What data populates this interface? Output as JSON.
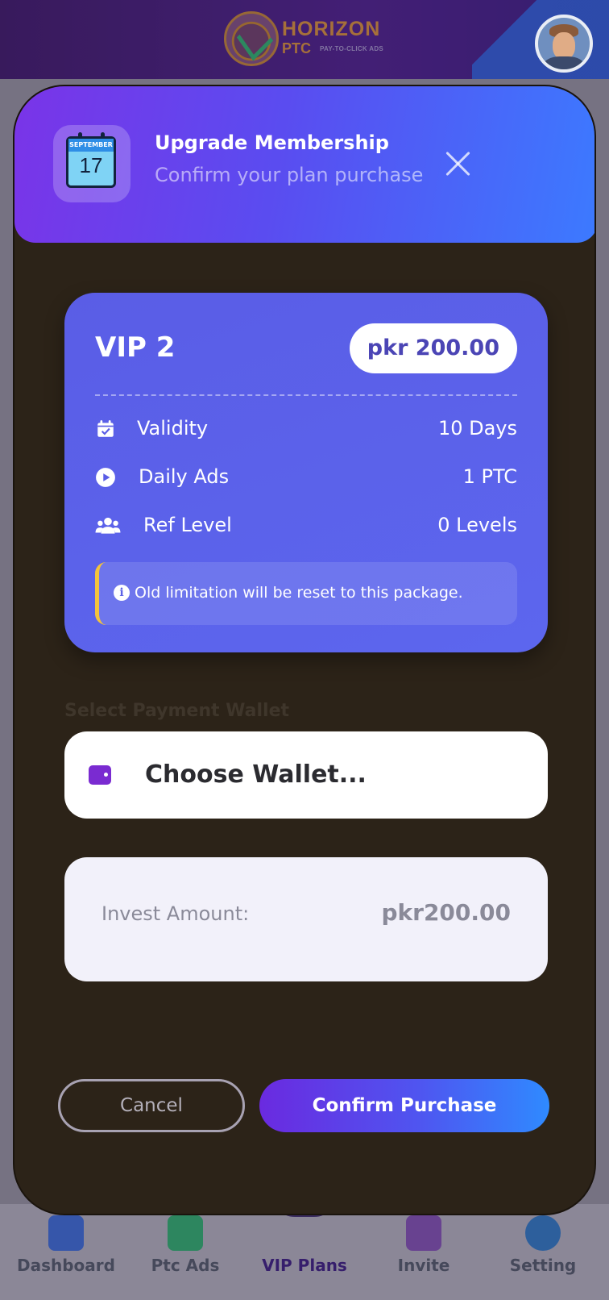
{
  "header": {
    "brand_name": "HORIZON",
    "brand_sub": "PTC",
    "brand_tag": "PAY-TO-CLICK ADS"
  },
  "bottom_nav": {
    "items": [
      {
        "label": "Dashboard",
        "icon": "dashboard-icon"
      },
      {
        "label": "Ptc Ads",
        "icon": "grid-plus-icon"
      },
      {
        "label": "VIP Plans",
        "icon": "crown-icon",
        "active": true
      },
      {
        "label": "Invite",
        "icon": "envelope-icon"
      },
      {
        "label": "Setting",
        "icon": "user-circle-icon"
      }
    ]
  },
  "modal": {
    "title": "Upgrade Membership",
    "subtitle": "Confirm your plan purchase",
    "calendar": {
      "month": "SEPTEMBER",
      "day": "17"
    },
    "plan": {
      "name": "VIP 2",
      "price": "pkr 200.00",
      "rows": [
        {
          "icon": "calendar-check-icon",
          "label": "Validity",
          "value": "10 Days"
        },
        {
          "icon": "play-circle-icon",
          "label": "Daily Ads",
          "value": "1 PTC"
        },
        {
          "icon": "users-icon",
          "label": "Ref Level",
          "value": "0 Levels"
        }
      ],
      "notice": "Old limitation will be reset to this package."
    },
    "wallet": {
      "label": "Select Payment Wallet",
      "placeholder": "Choose Wallet..."
    },
    "invest": {
      "label": "Invest Amount:",
      "value": "pkr200.00"
    },
    "buttons": {
      "cancel": "Cancel",
      "confirm": "Confirm Purchase"
    }
  },
  "colors": {
    "header_gradient_start": "#7a34e8",
    "header_gradient_end": "#3c7aff",
    "card": "#5a5de6",
    "notice_accent": "#f3c33c",
    "modal_bg": "#2c2318"
  }
}
